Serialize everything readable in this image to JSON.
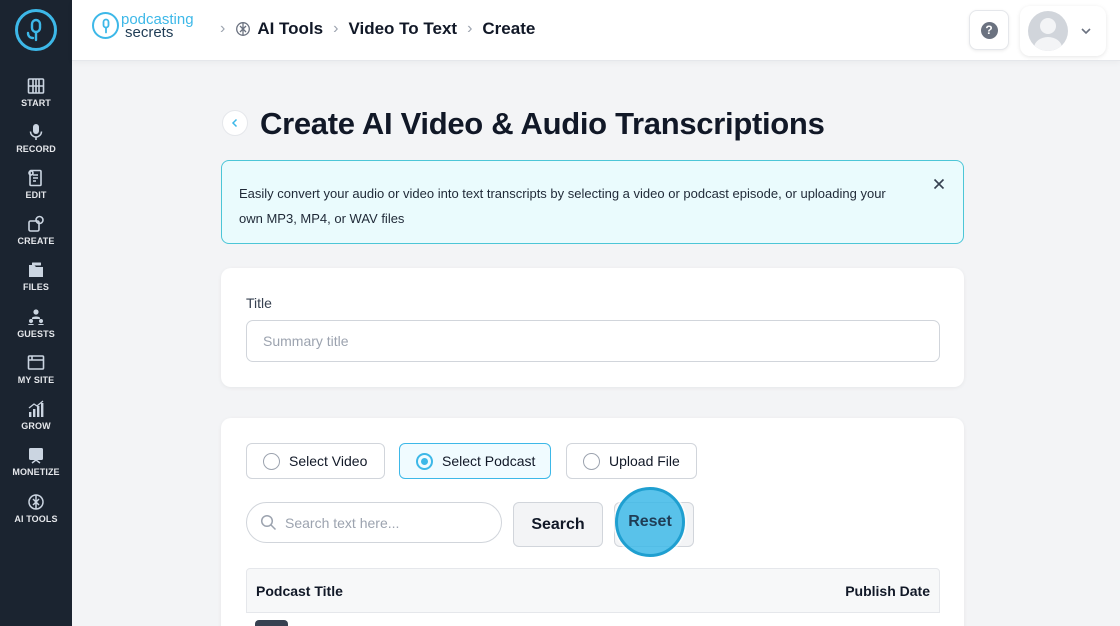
{
  "sidebar": {
    "items": [
      {
        "label": "START",
        "icon": "piano-icon"
      },
      {
        "label": "RECORD",
        "icon": "microphone-icon"
      },
      {
        "label": "EDIT",
        "icon": "edit-icon"
      },
      {
        "label": "CREATE",
        "icon": "create-icon"
      },
      {
        "label": "FILES",
        "icon": "files-icon"
      },
      {
        "label": "GUESTS",
        "icon": "guests-icon"
      },
      {
        "label": "MY SITE",
        "icon": "site-icon"
      },
      {
        "label": "GROW",
        "icon": "chart-icon"
      },
      {
        "label": "MONETIZE",
        "icon": "monetize-icon"
      },
      {
        "label": "AI TOOLS",
        "icon": "ai-icon"
      }
    ]
  },
  "header": {
    "brand_line1": "podcasting",
    "brand_line2": "secrets",
    "breadcrumbs": [
      "AI Tools",
      "Video To Text",
      "Create"
    ],
    "help_label": "?"
  },
  "page": {
    "title": "Create AI Video & Audio Transcriptions",
    "info_text": "Easily convert your audio or video into text transcripts by selecting a video or podcast episode, or uploading your own MP3, MP4, or WAV files"
  },
  "title_form": {
    "label": "Title",
    "placeholder": "Summary title",
    "value": ""
  },
  "source": {
    "options": [
      {
        "label": "Select Video",
        "selected": false
      },
      {
        "label": "Select Podcast",
        "selected": true
      },
      {
        "label": "Upload File",
        "selected": false
      }
    ],
    "search_placeholder": "Search text here...",
    "search_button": "Search",
    "reset_button": "Reset",
    "table_columns": [
      "Podcast Title",
      "Publish Date"
    ]
  },
  "colors": {
    "accent": "#3db8e8",
    "sidebar_bg": "#1b2430",
    "info_bg": "#eafbfd",
    "info_border": "#4cc6d7"
  }
}
